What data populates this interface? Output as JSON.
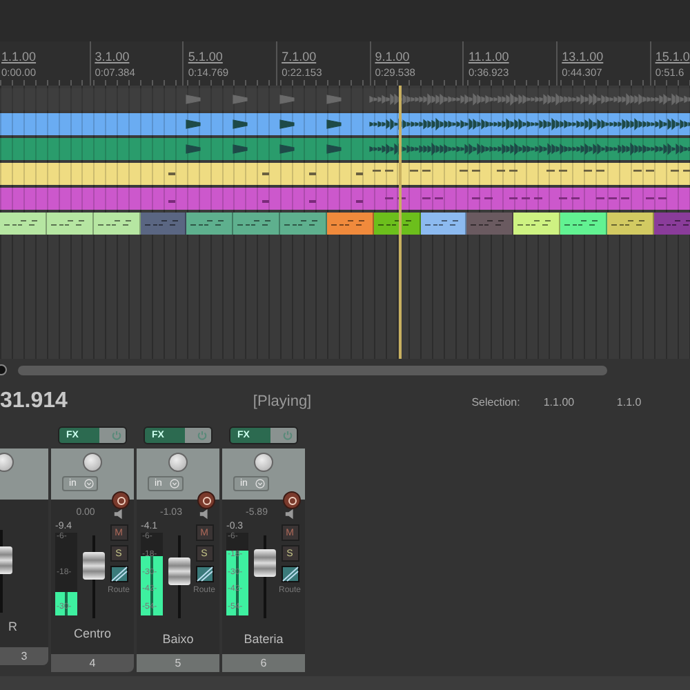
{
  "ruler": [
    {
      "bar": "1.1.00",
      "time": "0:00.00"
    },
    {
      "bar": "3.1.00",
      "time": "0:07.384"
    },
    {
      "bar": "5.1.00",
      "time": "0:14.769"
    },
    {
      "bar": "7.1.00",
      "time": "0:22.153"
    },
    {
      "bar": "9.1.00",
      "time": "0:29.538"
    },
    {
      "bar": "11.1.00",
      "time": "0:36.923"
    },
    {
      "bar": "13.1.00",
      "time": "0:44.307"
    },
    {
      "bar": "15.1.0",
      "time": "0:51.6"
    }
  ],
  "tracks": [
    {
      "kind": "audio",
      "color": "#3e3e3e"
    },
    {
      "kind": "audio",
      "color": "#6aacf2"
    },
    {
      "kind": "audio",
      "color": "#2a9c6c"
    },
    {
      "kind": "notes",
      "color": "#efdc82"
    },
    {
      "kind": "notes",
      "color": "#cc58cc"
    }
  ],
  "midi_items": [
    {
      "color": "#b6e6a2"
    },
    {
      "color": "#b6e6a2"
    },
    {
      "color": "#b6e6a2"
    },
    {
      "color": "#5a6682"
    },
    {
      "color": "#5eb08e"
    },
    {
      "color": "#5eb08e"
    },
    {
      "color": "#5eb08e"
    },
    {
      "color": "#f08a3c"
    },
    {
      "color": "#6cbf1c"
    },
    {
      "color": "#8cbaf0"
    },
    {
      "color": "#6a5a60"
    },
    {
      "color": "#cef282"
    },
    {
      "color": "#62f292"
    },
    {
      "color": "#d2ca62"
    },
    {
      "color": "#8a3c9a"
    }
  ],
  "transport": {
    "time": "31.914",
    "state": "[Playing]",
    "selection_label": "Selection:",
    "selection_start": "1.1.00",
    "selection_end": "1.1.0"
  },
  "mixer": {
    "strips": [
      {
        "kind": "partial",
        "name": "R",
        "number": "3",
        "fader": {
          "level": 0.7
        }
      },
      {
        "kind": "full",
        "fx": "FX",
        "input": "in",
        "volume": "0.00",
        "peak": "-9.4",
        "scale": [
          "-6-",
          "-18-",
          "-30-"
        ],
        "meter": {
          "level": 0.28
        },
        "fader": {
          "level": 0.7
        },
        "mute": "M",
        "solo": "S",
        "route": "Route",
        "name": "Centro",
        "number": "4"
      },
      {
        "kind": "full",
        "fx": "FX",
        "input": "in",
        "volume": "-1.03",
        "peak": "-4.1",
        "scale": [
          "-6-",
          "-18-",
          "-30-",
          "-42-",
          "-54-"
        ],
        "meter": {
          "level": 0.72
        },
        "fader": {
          "level": 0.6
        },
        "mute": "M",
        "solo": "S",
        "route": "Route",
        "name": "Baixo",
        "number": "5"
      },
      {
        "kind": "full",
        "fx": "FX",
        "input": "in",
        "volume": "-5.89",
        "peak": "-0.3",
        "scale": [
          "-6-",
          "-18-",
          "-30-",
          "-42-",
          "-54-"
        ],
        "meter": {
          "level": 0.78
        },
        "fader": {
          "level": 0.75
        },
        "mute": "M",
        "solo": "S",
        "route": "Route",
        "name": "Bateria",
        "number": "6"
      }
    ]
  }
}
